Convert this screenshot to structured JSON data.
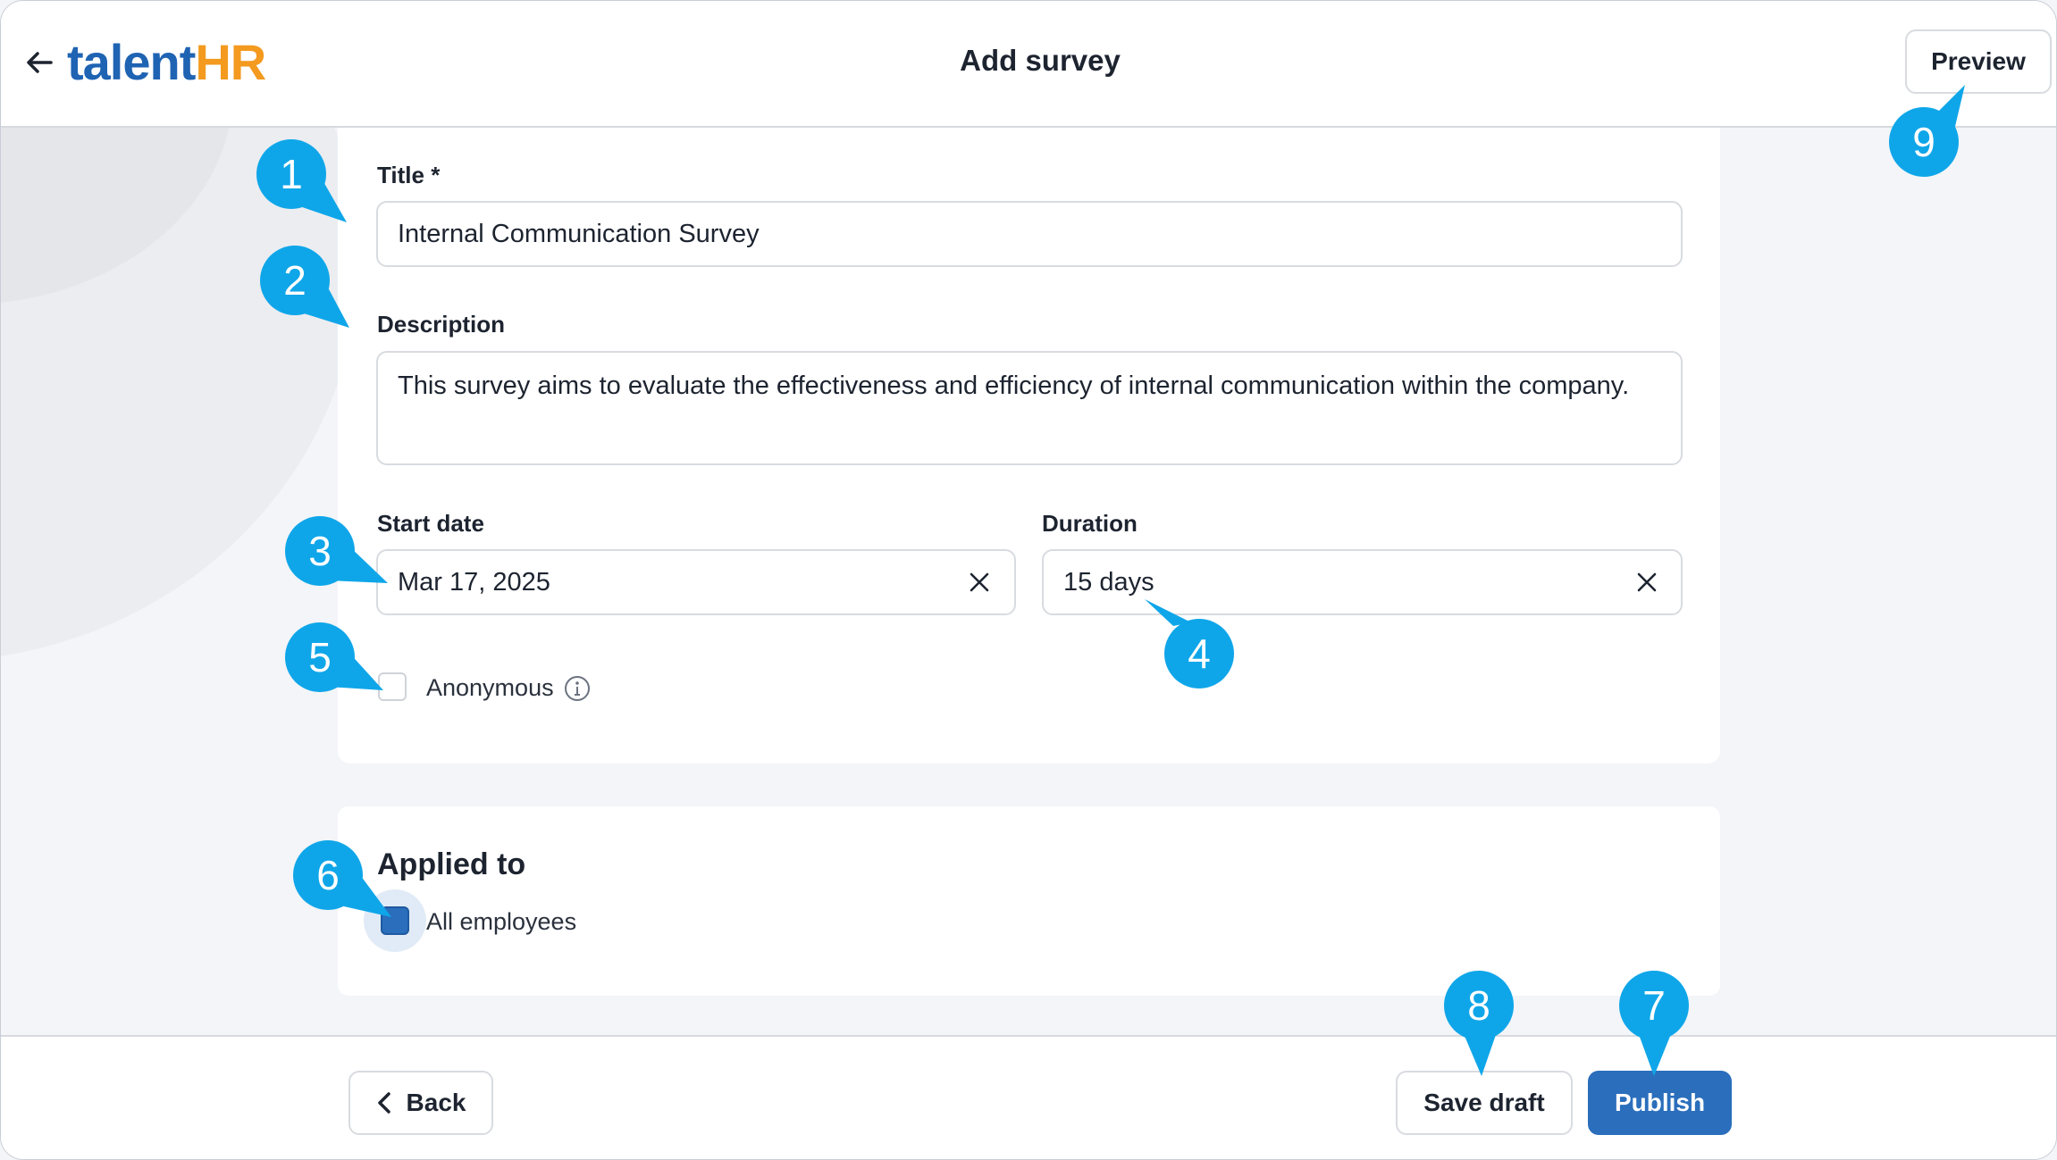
{
  "header": {
    "title": "Add survey",
    "logo_part1": "talent",
    "logo_part2": "HR",
    "preview_label": "Preview"
  },
  "form": {
    "title_label": "Title *",
    "title_value": "Internal Communication Survey",
    "description_label": "Description",
    "description_value": "This survey aims to evaluate the effectiveness and efficiency of internal communication within the company.",
    "start_date_label": "Start date",
    "start_date_value": "Mar 17, 2025",
    "duration_label": "Duration",
    "duration_value": "15 days",
    "anonymous_label": "Anonymous",
    "anonymous_checked": false
  },
  "applied": {
    "title": "Applied to",
    "all_employees_label": "All employees",
    "all_employees_checked": true
  },
  "footer": {
    "back_label": "Back",
    "save_draft_label": "Save draft",
    "publish_label": "Publish"
  },
  "callouts": [
    "1",
    "2",
    "3",
    "4",
    "5",
    "6",
    "7",
    "8",
    "9"
  ],
  "colors": {
    "brand_blue": "#1f63b3",
    "brand_orange": "#f39a1f",
    "primary_button": "#2a6ebc",
    "callout": "#0fa6e9"
  }
}
